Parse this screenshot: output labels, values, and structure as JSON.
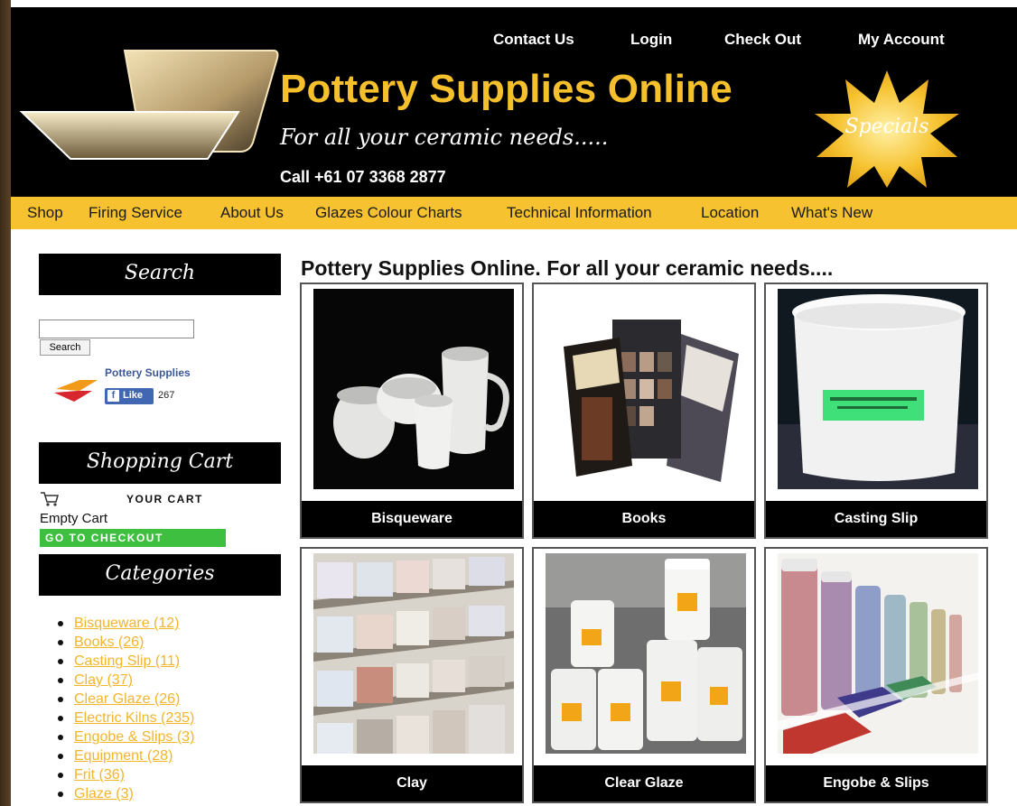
{
  "header": {
    "title": "Pottery Supplies Online",
    "tagline": "For all your ceramic needs.....",
    "phone": "Call +61 07 3368 2877",
    "specials_label": "Specials",
    "top_links": [
      "Contact Us",
      "Login",
      "Check Out",
      "My Account"
    ]
  },
  "nav": {
    "items": [
      "Shop",
      "Firing Service",
      "About Us",
      "Glazes Colour Charts",
      "Technical Information",
      "Location",
      "What's New"
    ]
  },
  "sidebar": {
    "search_heading": "Search",
    "search_placeholder": "",
    "search_button": "Search",
    "fb_page_name": "Pottery Supplies",
    "fb_like_label": "Like",
    "fb_like_count": "267",
    "cart_heading": "Shopping Cart",
    "your_cart": "YOUR CART",
    "empty_cart": "Empty Cart",
    "checkout_label": "GO TO CHECKOUT",
    "categories_heading": "Categories",
    "categories": [
      "Bisqueware (12)",
      "Books (26)",
      "Casting Slip (11)",
      "Clay (37)",
      "Clear Glaze (26)",
      "Electric Kilns (235)",
      "Engobe & Slips (3)",
      "Equipment (28)",
      "Frit (36)",
      "Glaze (3)"
    ]
  },
  "main": {
    "title": "Pottery Supplies Online. For all your ceramic needs....",
    "tiles": [
      "Bisqueware",
      "Books",
      "Casting Slip",
      "Clay",
      "Clear Glaze",
      "Engobe & Slips"
    ]
  },
  "colors": {
    "accent_yellow": "#f6c230",
    "header_black": "#000000",
    "checkout_green": "#3fbf3f",
    "link_gold": "#f2b52b"
  }
}
